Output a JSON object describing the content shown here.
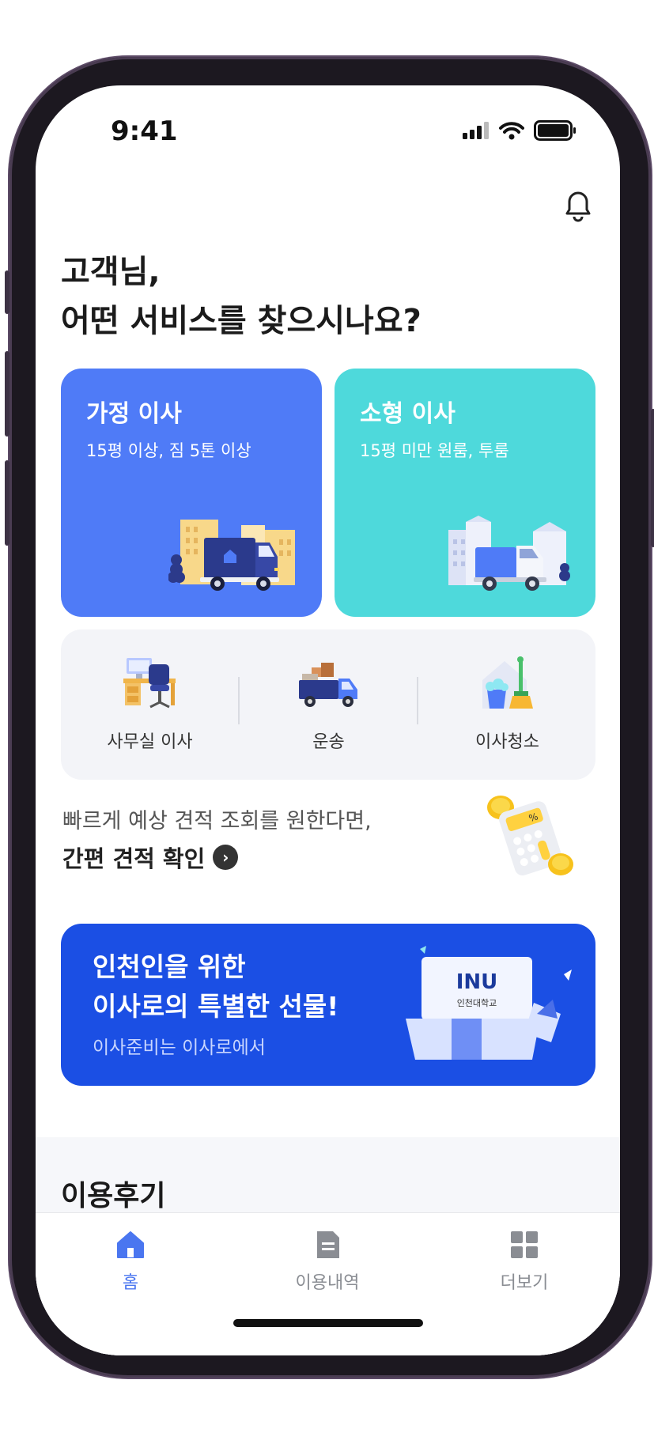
{
  "status_bar": {
    "time": "9:41"
  },
  "header": {
    "greeting_line1": "고객님,",
    "greeting_line2": "어떤 서비스를 찾으시나요?"
  },
  "main_cards": [
    {
      "title": "가정 이사",
      "subtitle": "15평 이상, 짐 5톤 이상",
      "color": "#4f7bf7"
    },
    {
      "title": "소형 이사",
      "subtitle": "15평 미만 원룸, 투룸",
      "color": "#4ed9db"
    }
  ],
  "services": [
    {
      "label": "사무실 이사",
      "icon": "office-desk-icon"
    },
    {
      "label": "운송",
      "icon": "delivery-truck-icon"
    },
    {
      "label": "이사청소",
      "icon": "cleaning-icon"
    }
  ],
  "quick_estimate": {
    "line1": "빠르게 예상 견적 조회를 원한다면,",
    "link_label": "간편 견적 확인"
  },
  "banner": {
    "line1": "인천인을 위한",
    "line2": "이사로의 특별한 선물!",
    "subtitle": "이사준비는 이사로에서",
    "logo_text": "INU",
    "logo_subtext": "인천대학교",
    "color": "#1b4fe4"
  },
  "reviews": {
    "title": "이용후기"
  },
  "tab_bar": {
    "active_color": "#4a76f0",
    "inactive_color": "#8a8d93",
    "tabs": [
      {
        "label": "홈",
        "icon": "home-icon",
        "active": true
      },
      {
        "label": "이용내역",
        "icon": "document-icon",
        "active": false
      },
      {
        "label": "더보기",
        "icon": "grid-icon",
        "active": false
      }
    ]
  }
}
